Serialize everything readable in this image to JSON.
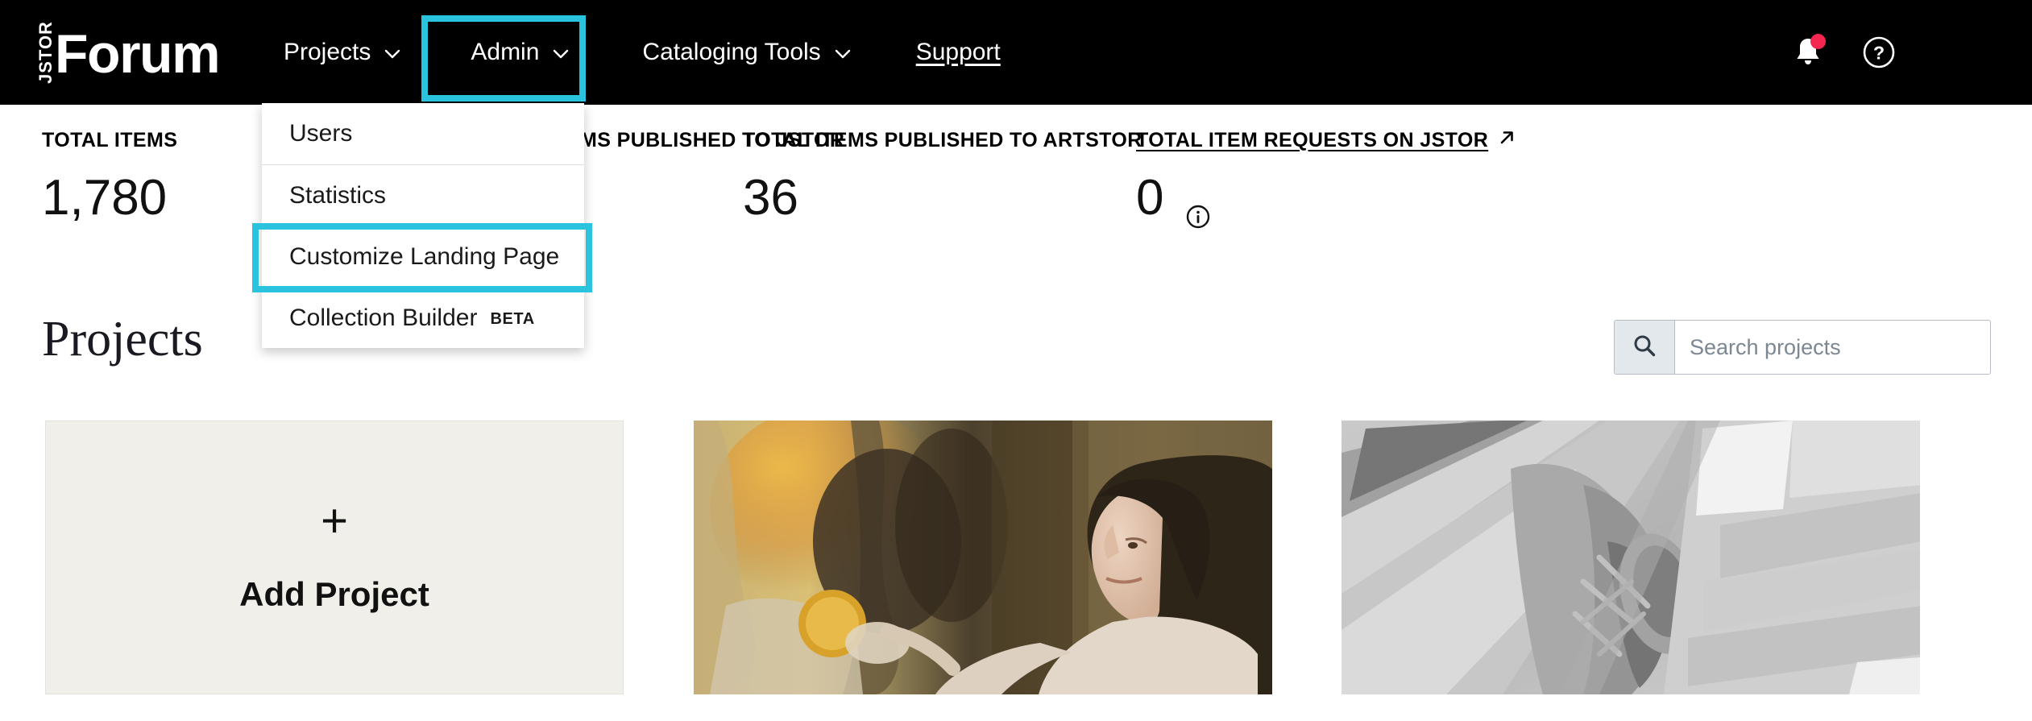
{
  "brand": {
    "logo_small": "JSTOR",
    "logo_main": "Forum"
  },
  "nav": {
    "items": [
      {
        "label": "Projects",
        "icon": "chevron-down-icon",
        "has_chevron": true,
        "underlined": false
      },
      {
        "label": "Admin",
        "icon": "chevron-down-icon",
        "has_chevron": true,
        "underlined": false,
        "highlighted": true
      },
      {
        "label": "Cataloging Tools",
        "icon": "chevron-down-icon",
        "has_chevron": true,
        "underlined": false
      },
      {
        "label": "Support",
        "icon": "",
        "has_chevron": false,
        "underlined": true
      }
    ],
    "right_icons": [
      {
        "name": "notifications-bell-icon",
        "badge": true
      },
      {
        "name": "help-circle-icon",
        "badge": false
      }
    ]
  },
  "admin_dropdown": {
    "open": true,
    "items": [
      {
        "label": "Users",
        "badge": ""
      },
      {
        "label": "Statistics",
        "badge": ""
      },
      {
        "label": "Customize Landing Page",
        "badge": "",
        "highlighted": true
      },
      {
        "label": "Collection Builder",
        "badge": "BETA"
      }
    ]
  },
  "stats": [
    {
      "label": "TOTAL ITEMS",
      "value": "1,780",
      "is_link": false,
      "has_info": false
    },
    {
      "label": "TOTAL ITEMS PUBLISHED TO JSTOR",
      "value": "",
      "is_link": false,
      "has_info": false
    },
    {
      "label": "TOTAL ITEMS PUBLISHED TO ARTSTOR",
      "value": "36",
      "is_link": false,
      "has_info": false
    },
    {
      "label": "TOTAL ITEM REQUESTS ON JSTOR",
      "value": "0",
      "is_link": true,
      "has_info": true
    }
  ],
  "projects_section": {
    "heading": "Projects",
    "search": {
      "placeholder": "Search projects",
      "value": "",
      "icon": "search-icon"
    },
    "cards": [
      {
        "type": "add",
        "plus": "+",
        "label": "Add Project"
      },
      {
        "type": "thumbnail",
        "label": "",
        "description": "painting of a woman in profile holding a golden disc"
      },
      {
        "type": "thumbnail",
        "label": "",
        "description": "black and white photograph of carved stone architectural detail"
      }
    ]
  },
  "colors": {
    "highlight": "#2ac3de",
    "topnav_bg": "#000000",
    "badge_red": "#f5264f",
    "card_bg": "#f0efe9"
  }
}
